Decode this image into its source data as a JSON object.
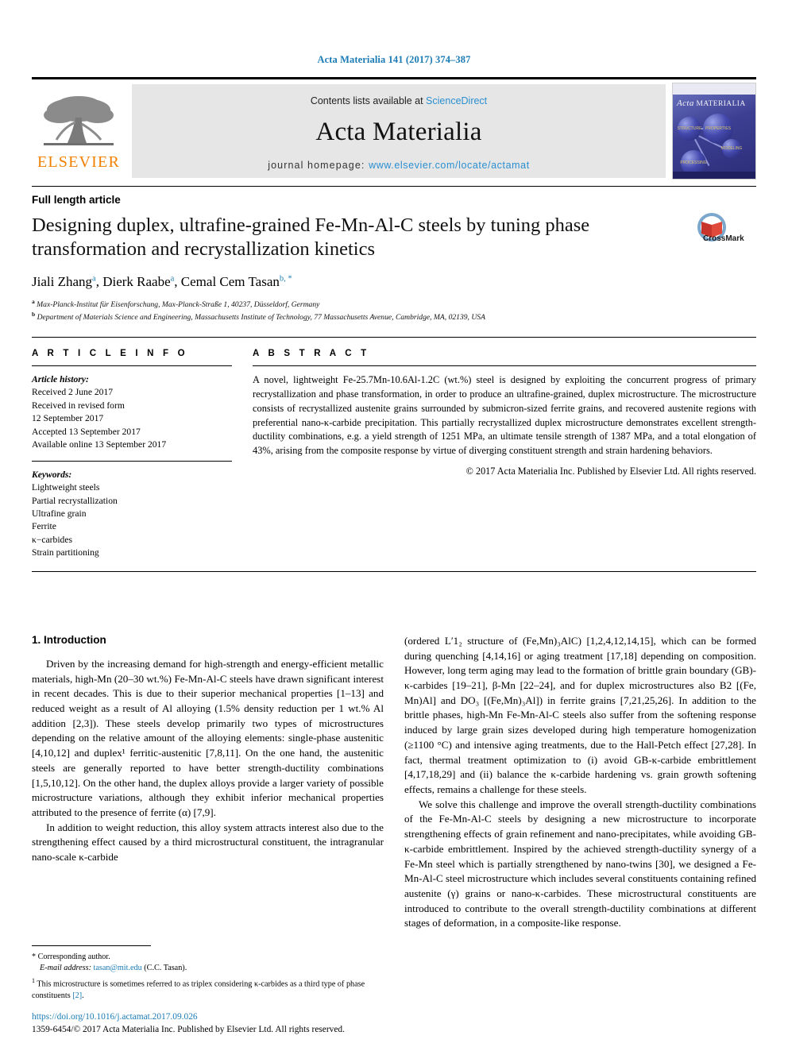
{
  "running_head": "Acta Materialia 141 (2017) 374–387",
  "masthead": {
    "publisher_logo_name": "elsevier-tree-logo",
    "publisher_wordmark": "ELSEVIER",
    "contents_prefix": "Contents lists available at ",
    "contents_link": "ScienceDirect",
    "journal_title": "Acta Materialia",
    "homepage_prefix": "journal homepage: ",
    "homepage_url": "www.elsevier.com/locate/actamat",
    "cover": {
      "title_italic": "Acta",
      "title_rest": "MATERIALIA",
      "nodes": [
        "STRUCTURE",
        "PROPERTIES",
        "MODELING",
        "PROCESSING"
      ]
    }
  },
  "article": {
    "type_label": "Full length article",
    "title": "Designing duplex, ultrafine-grained Fe-Mn-Al-C steels by tuning phase transformation and recrystallization kinetics",
    "crossmark_label": "CrossMark",
    "authors": [
      {
        "name": "Jiali Zhang",
        "sup": "a"
      },
      {
        "name": "Dierk Raabe",
        "sup": "a"
      },
      {
        "name": "Cemal Cem Tasan",
        "sup": "b, *"
      }
    ],
    "affiliations": [
      {
        "marker": "a",
        "text": "Max-Planck-Institut für Eisenforschung, Max-Planck-Straße 1, 40237, Düsseldorf, Germany"
      },
      {
        "marker": "b",
        "text": "Department of Materials Science and Engineering, Massachusetts Institute of Technology, 77 Massachusetts Avenue, Cambridge, MA, 02139, USA"
      }
    ]
  },
  "info": {
    "heading": "A R T I C L E   I N F O",
    "history_label": "Article history:",
    "history": [
      "Received 2 June 2017",
      "Received in revised form",
      "12 September 2017",
      "Accepted 13 September 2017",
      "Available online 13 September 2017"
    ],
    "keywords_label": "Keywords:",
    "keywords": [
      "Lightweight steels",
      "Partial recrystallization",
      "Ultrafine grain",
      "Ferrite",
      "κ−carbides",
      "Strain partitioning"
    ]
  },
  "abstract": {
    "heading": "A B S T R A C T",
    "body": "A novel, lightweight Fe-25.7Mn-10.6Al-1.2C (wt.%) steel is designed by exploiting the concurrent progress of primary recrystallization and phase transformation, in order to produce an ultrafine-grained, duplex microstructure. The microstructure consists of recrystallized austenite grains surrounded by submicron-sized ferrite grains, and recovered austenite regions with preferential nano-κ-carbide precipitation. This partially recrystallized duplex microstructure demonstrates excellent strength-ductility combinations, e.g. a yield strength of 1251 MPa, an ultimate tensile strength of 1387 MPa, and a total elongation of 43%, arising from the composite response by virtue of diverging constituent strength and strain hardening behaviors.",
    "copyright": "© 2017 Acta Materialia Inc. Published by Elsevier Ltd. All rights reserved."
  },
  "body": {
    "section_number_title": "1. Introduction",
    "left_paragraphs": [
      "Driven by the increasing demand for high-strength and energy-efficient metallic materials, high-Mn (20–30 wt.%) Fe-Mn-Al-C steels have drawn significant interest in recent decades. This is due to their superior mechanical properties [1–13] and reduced weight as a result of Al alloying (1.5% density reduction per 1 wt.% Al addition [2,3]). These steels develop primarily two types of microstructures depending on the relative amount of the alloying elements: single-phase austenitic [4,10,12] and duplex¹ ferritic-austenitic [7,8,11]. On the one hand, the austenitic steels are generally reported to have better strength-ductility combinations [1,5,10,12]. On the other hand, the duplex alloys provide a larger variety of possible microstructure variations, although they exhibit inferior mechanical properties attributed to the presence of ferrite (α) [7,9].",
      "In addition to weight reduction, this alloy system attracts interest also due to the strengthening effect caused by a third microstructural constituent, the intragranular nano-scale κ-carbide"
    ],
    "right_paragraphs": [
      "(ordered L′1₂ structure of (Fe,Mn)₃AlC) [1,2,4,12,14,15], which can be formed during quenching [4,14,16] or aging treatment [17,18] depending on composition. However, long term aging may lead to the formation of brittle grain boundary (GB)-κ-carbides [19–21], β-Mn [22–24], and for duplex microstructures also B2 [(Fe, Mn)Al] and DO₃ [(Fe,Mn)₃Al]) in ferrite grains [7,21,25,26]. In addition to the brittle phases, high-Mn Fe-Mn-Al-C steels also suffer from the softening response induced by large grain sizes developed during high temperature homogenization (≥1100 °C) and intensive aging treatments, due to the Hall-Petch effect [27,28]. In fact, thermal treatment optimization to (i) avoid GB-κ-carbide embrittlement [4,17,18,29] and (ii) balance the κ-carbide hardening vs. grain growth softening effects, remains a challenge for these steels.",
      "We solve this challenge and improve the overall strength-ductility combinations of the Fe-Mn-Al-C steels by designing a new microstructure to incorporate strengthening effects of grain refinement and nano-precipitates, while avoiding GB-κ-carbide embrittlement. Inspired by the achieved strength-ductility synergy of a Fe-Mn steel which is partially strengthened by nano-twins [30], we designed a Fe-Mn-Al-C steel microstructure which includes several constituents containing refined austenite (γ) grains or nano-κ-carbides. These microstructural constituents are introduced to contribute to the overall strength-ductility combinations at different stages of deformation, in a composite-like response."
    ]
  },
  "footnotes": {
    "corresponding_marker": "*",
    "corresponding_label": "Corresponding author.",
    "email_label": "E-mail address:",
    "email": "tasan@mit.edu",
    "email_owner": "(C.C. Tasan).",
    "note_marker": "1",
    "note_text_a": "This microstructure is sometimes referred to as triplex considering κ-carbides as a third type of phase constituents ",
    "note_ref": "[2]",
    "note_text_b": "."
  },
  "doi_block": {
    "doi": "https://doi.org/10.1016/j.actamat.2017.09.026",
    "issn_line": "1359-6454/© 2017 Acta Materialia Inc. Published by Elsevier Ltd. All rights reserved."
  },
  "colors": {
    "link_blue": "#1a7bb5",
    "sciencedirect_blue": "#2a8fd0",
    "elsevier_orange": "#F08000",
    "masthead_gray": "#e6e6e6"
  }
}
